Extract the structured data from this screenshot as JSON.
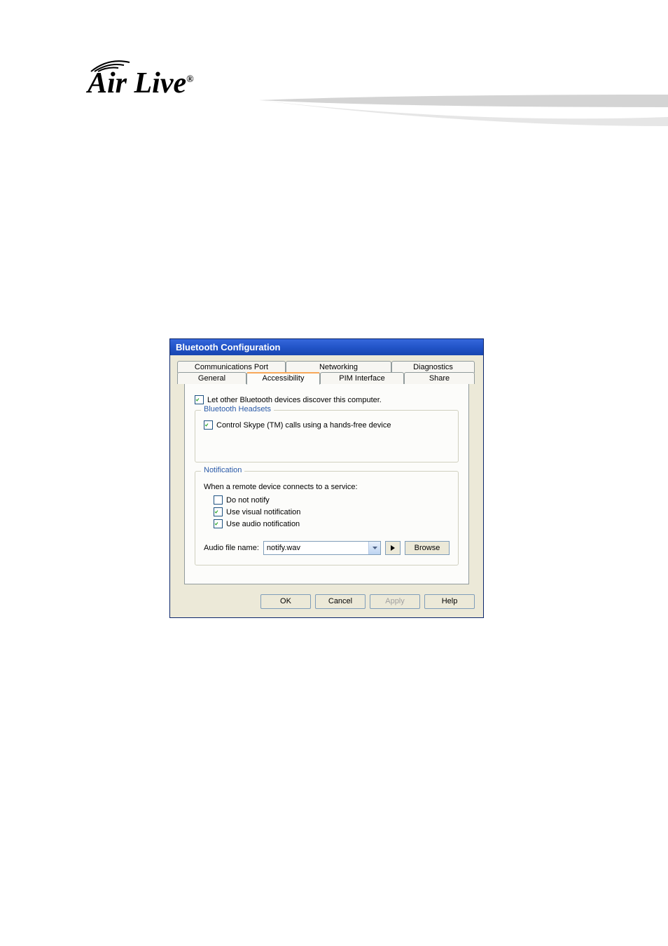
{
  "logo": {
    "text": "Air Live",
    "reg": "®"
  },
  "dialog": {
    "title": "Bluetooth Configuration",
    "tabs_back": [
      {
        "label": "Communications Port"
      },
      {
        "label": "Networking"
      },
      {
        "label": "Diagnostics"
      }
    ],
    "tabs_front": [
      {
        "label": "General"
      },
      {
        "label": "Accessibility",
        "active": true
      },
      {
        "label": "PIM Interface"
      },
      {
        "label": "Share"
      }
    ],
    "discover_label": "Let other Bluetooth devices discover this computer.",
    "headsets": {
      "legend": "Bluetooth Headsets",
      "skype_label": "Control Skype (TM) calls using a hands-free device"
    },
    "notification": {
      "legend": "Notification",
      "intro": "When a remote device connects to a service:",
      "do_not_notify": "Do not notify",
      "visual": "Use visual notification",
      "audio": "Use audio notification",
      "audio_file_label": "Audio file name:",
      "audio_file_value": "notify.wav",
      "browse": "Browse"
    },
    "buttons": {
      "ok": "OK",
      "cancel": "Cancel",
      "apply": "Apply",
      "help": "Help"
    }
  }
}
